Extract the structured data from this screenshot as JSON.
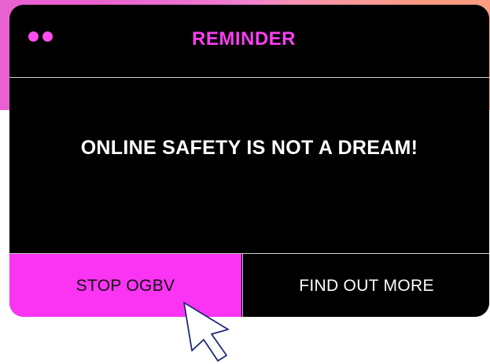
{
  "dialog": {
    "title": "REMINDER",
    "message": "ONLINE SAFETY IS NOT A DREAM!",
    "buttons": {
      "primary_label": "STOP OGBV",
      "secondary_label": "FIND OUT MORE"
    },
    "window_dots": 2
  },
  "colors": {
    "accent": "#fb33f3",
    "title_text": "#f83ff0",
    "dialog_background": "#000000",
    "divider": "#cfcfcf"
  },
  "icons": {
    "pointer": "mouse-pointer-icon"
  }
}
